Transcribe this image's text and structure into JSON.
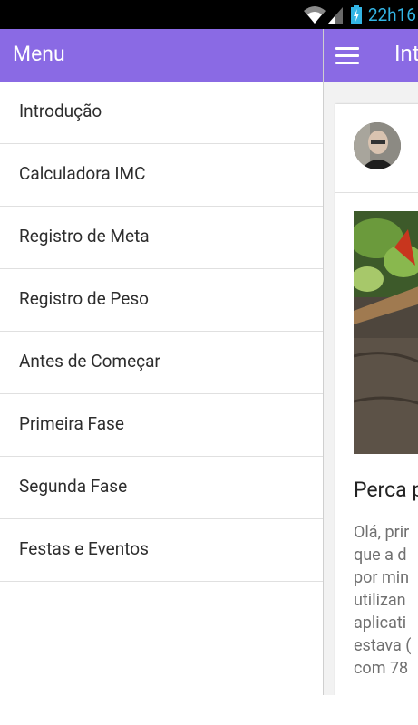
{
  "status_bar": {
    "time": "22h16",
    "icons": [
      "wifi-icon",
      "signal-icon",
      "battery-charging-icon"
    ]
  },
  "drawer": {
    "title": "Menu",
    "items": [
      {
        "label": "Introdução"
      },
      {
        "label": "Calculadora IMC"
      },
      {
        "label": "Registro de Meta"
      },
      {
        "label": "Registro de Peso"
      },
      {
        "label": "Antes de Começar"
      },
      {
        "label": "Primeira Fase"
      },
      {
        "label": "Segunda Fase"
      },
      {
        "label": "Festas e Eventos"
      }
    ]
  },
  "main": {
    "title": "Int",
    "card": {
      "title": "Perca p",
      "text_lines": [
        "Olá, prir",
        "que a d",
        "por min",
        "utilizan",
        "aplicati",
        "estava (",
        "com 78"
      ]
    }
  },
  "colors": {
    "toolbar": "#8a6ae4",
    "status_accent": "#33b5e5"
  }
}
